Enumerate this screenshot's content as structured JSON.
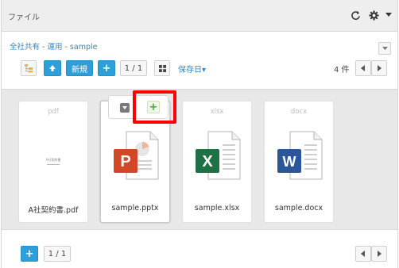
{
  "titlebar": {
    "title": "ファイル",
    "refresh_icon": "refresh-icon",
    "gear_icon": "gear-icon",
    "caret_icon": "caret-down-icon"
  },
  "breadcrumb": {
    "path": "全社共有 - 運用 - sample"
  },
  "toolbar": {
    "new_label": "新規",
    "add_label": "+",
    "page_label": "1 / 1",
    "sort_label": "保存日▾",
    "count_label": "4 件"
  },
  "files": [
    {
      "ext": "pdf",
      "name": "A社契約書.pdf",
      "preview_title": "A社契約書"
    },
    {
      "ext": "",
      "name": "sample.pptx"
    },
    {
      "ext": "xlsx",
      "name": "sample.xlsx"
    },
    {
      "ext": "docx",
      "name": "sample.docx"
    }
  ],
  "hover_tools": {
    "plus_label": "+"
  },
  "footer": {
    "add_label": "+",
    "page_label": "1 / 1"
  },
  "colors": {
    "accent": "#2f9fd9",
    "powerpoint": "#d24726",
    "excel": "#1e7145",
    "word": "#2b579a",
    "highlight": "#ff0000"
  }
}
